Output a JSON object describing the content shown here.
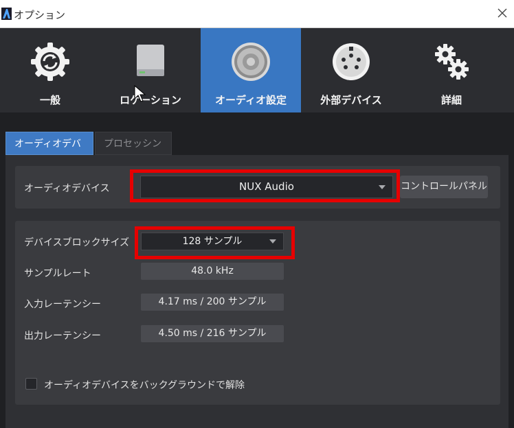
{
  "window": {
    "title": "オプション"
  },
  "toolbar": {
    "items": [
      {
        "label": "一般",
        "icon": "refresh-gear-icon"
      },
      {
        "label": "ロケーション",
        "icon": "drive-icon"
      },
      {
        "label": "オーディオ設定",
        "icon": "speaker-icon"
      },
      {
        "label": "外部デバイス",
        "icon": "midi-port-icon"
      },
      {
        "label": "詳細",
        "icon": "gears-icon"
      }
    ],
    "active_index": 2,
    "active_color": "#3977c2"
  },
  "tabs": [
    {
      "label": "オーディオデバイス",
      "active": true
    },
    {
      "label": "プロセッシング",
      "active": false
    }
  ],
  "audio_device": {
    "label": "オーディオデバイス",
    "value": "NUX Audio",
    "control_panel_label": "コントロールパネル"
  },
  "settings": {
    "block_size_label": "デバイスブロックサイズ",
    "block_size_value": "128 サンプル",
    "sample_rate_label": "サンプルレート",
    "sample_rate_value": "48.0 kHz",
    "input_latency_label": "入力レーテンシー",
    "input_latency_value": "4.17 ms / 200 サンプル",
    "output_latency_label": "出力レーテンシー",
    "output_latency_value": "4.50 ms / 216 サンプル",
    "release_bg_label": "オーディオデバイスをバックグラウンドで解除",
    "release_bg_checked": false
  },
  "colors": {
    "highlight": "#e60000"
  }
}
